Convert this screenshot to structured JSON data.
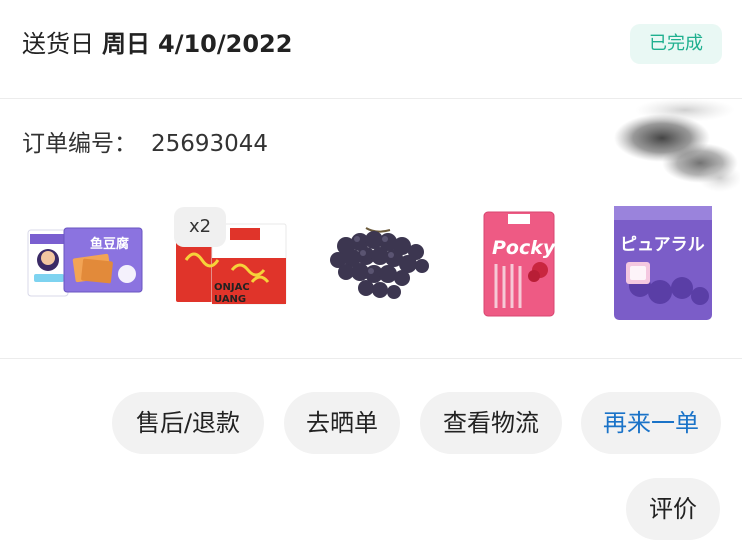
{
  "header": {
    "delivery_label": "送货日",
    "delivery_day": "周日",
    "delivery_date": "4/10/2022",
    "status": "已完成"
  },
  "order": {
    "label": "订单编号：",
    "number": "25693044"
  },
  "products": [
    {
      "name": "鱼豆腐",
      "quantity_label": ""
    },
    {
      "name": "SPICY KONJAC",
      "quantity_label": "x2"
    },
    {
      "name": "grapes",
      "quantity_label": ""
    },
    {
      "name": "Pocky",
      "quantity_label": ""
    },
    {
      "name": "ピュアラル",
      "quantity_label": ""
    }
  ],
  "product_text": {
    "tofu_title": "鱼豆腐",
    "konjac_line1": "ONJAC",
    "konjac_line2": "UANG",
    "pocky_brand": "Pocky",
    "gummy_brand": "ピュアラル"
  },
  "actions": {
    "refund": "售后/退款",
    "share": "去晒单",
    "logistics": "查看物流",
    "reorder": "再来一单",
    "review": "评价"
  },
  "colors": {
    "status_text": "#1fb08f",
    "status_bg": "#e9f8f4",
    "primary_action": "#1a73c8",
    "button_bg": "#f2f2f2"
  }
}
